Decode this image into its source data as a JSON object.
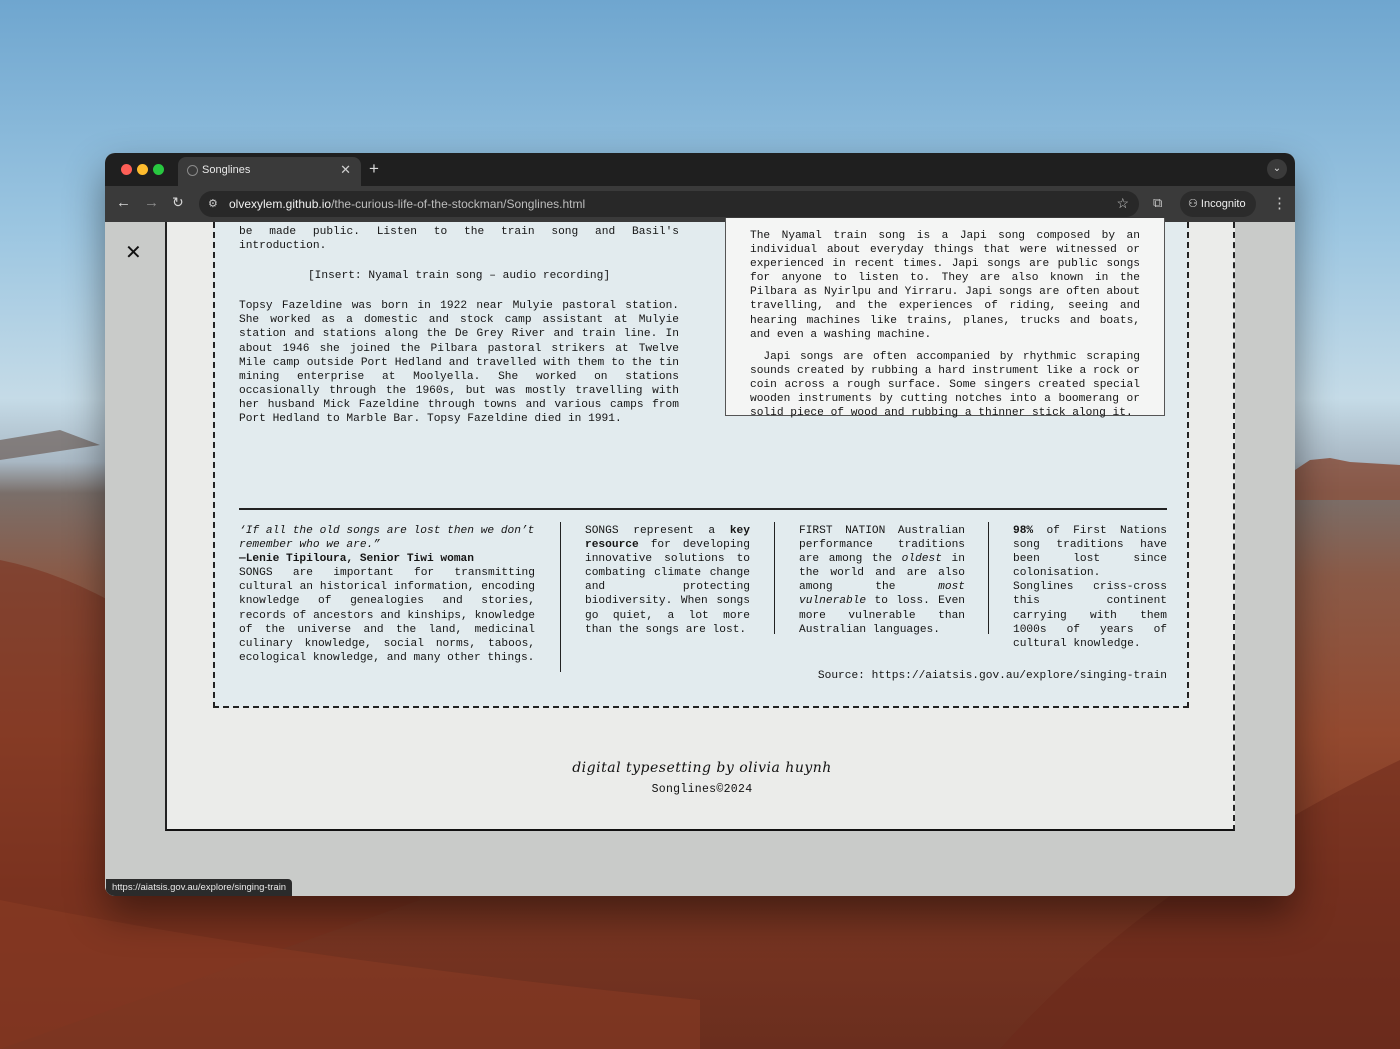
{
  "browser": {
    "tab_title": "Songlines",
    "url_host": "olvexylem.github.io",
    "url_path": "/the-curious-life-of-the-stockman/Songlines.html",
    "incognito_label": "Incognito",
    "status_url": "https://aiatsis.gov.au/explore/singing-train",
    "icons": {
      "back": "arrow-left-icon",
      "forward": "arrow-right-icon",
      "reload": "reload-icon",
      "site_info": "tune-icon",
      "bookmark": "star-icon",
      "extensions": "extension-icon",
      "incognito": "incognito-icon",
      "menu": "kebab-menu-icon",
      "tab_search": "chevron-down-icon",
      "close": "close-icon"
    }
  },
  "article": {
    "intro_tail": "be made public. Listen to the train song and Basil's introduction.",
    "insert_note": "[Insert: Nyamal train song – audio recording]",
    "topsy_bio": "Topsy Fazeldine was born in 1922 near Mulyie pastoral station. She worked as a domestic and stock camp assistant at Mulyie station and stations along the De Grey River and train line. In about 1946 she joined the Pilbara pastoral strikers at Twelve Mile camp outside Port Hedland and travelled with them to the tin mining enterprise at Moolyella. She worked on stations occasionally through the 1960s, but was mostly travelling with her husband Mick Fazeldine through towns and various camps from Port Hedland to Marble Bar. Topsy Fazeldine died in 1991.",
    "sidebar_p1": "The Nyamal train song is a Japi song composed by an individual about everyday things that were witnessed or experienced in recent times. Japi songs are public songs for anyone to listen to. They are also known in the Pilbara as Nyirlpu and Yirraru. Japi songs are often about travelling, and the experiences of riding, seeing and hearing machines like trains, planes, trucks and boats, and even a washing machine.",
    "sidebar_p2": "Japi songs are often accompanied by rhythmic scraping sounds created by rubbing a hard instrument like a rock or coin across a rough surface. Some singers created special wooden instruments by cutting notches into a boomerang or solid piece of wood and rubbing a thinner stick along it.",
    "quote": "‘If all the old songs are lost then we don’t remember who we are.”",
    "quote_attribution": "—Lenie Tipiloura, Senior Tiwi woman",
    "col1_text": "SONGS are important for transmitting cultural an historical information, encoding knowledge of genealogies and stories, records of ancestors and kinships, knowledge of the universe and the land, medicinal culinary knowledge, social norms, taboos, ecological knowledge, and many other things.",
    "col2_pre": "SONGS represent a ",
    "col2_bold": "key resource",
    "col2_post": " for developing innovative solutions to combating climate change and protecting biodiversity. When songs go quiet, a lot more than the songs are lost.",
    "col3_a": "FIRST NATION Australian performance traditions are among the ",
    "col3_em1": "oldest",
    "col3_b": " in the world and are also among the ",
    "col3_em2": "most vulnerable",
    "col3_c": " to loss. Even more vulnerable than Australian languages.",
    "col4_bold": "98%",
    "col4_text": " of First Nations song traditions have been lost since colonisation. Songlines criss-cross this continent carrying with them 1000s of years of cultural knowledge.",
    "source": "Source: https://aiatsis.gov.au/explore/singing-train"
  },
  "footer": {
    "credit": "digital typesetting by olivia huynh",
    "copyright": "Songlines©2024"
  }
}
